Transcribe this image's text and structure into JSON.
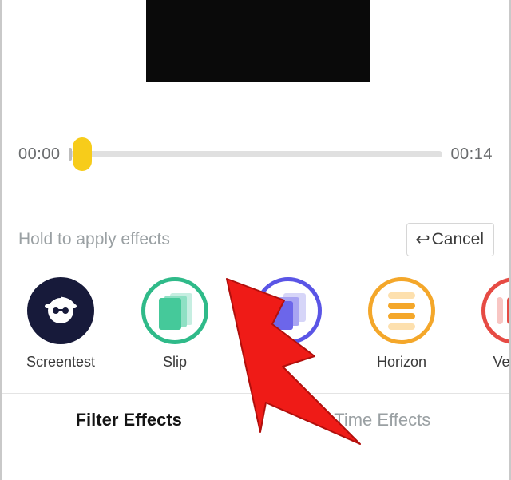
{
  "timeline": {
    "start": "00:00",
    "end": "00:14"
  },
  "hint": "Hold to apply effects",
  "cancel_label": "Cancel",
  "effects": {
    "screentest": "Screentest",
    "slip": "Slip",
    "soul": "",
    "horizon": "Horizon",
    "vertical": "Vertica"
  },
  "tabs": {
    "filter": "Filter Effects",
    "time": "Time Effects"
  },
  "colors": {
    "playhead": "#f7cc1a",
    "slip": "#2fba89",
    "soul": "#5a55e6",
    "horizon": "#f4a72a",
    "vertical": "#e64b44",
    "arrow": "#ef1b17"
  }
}
